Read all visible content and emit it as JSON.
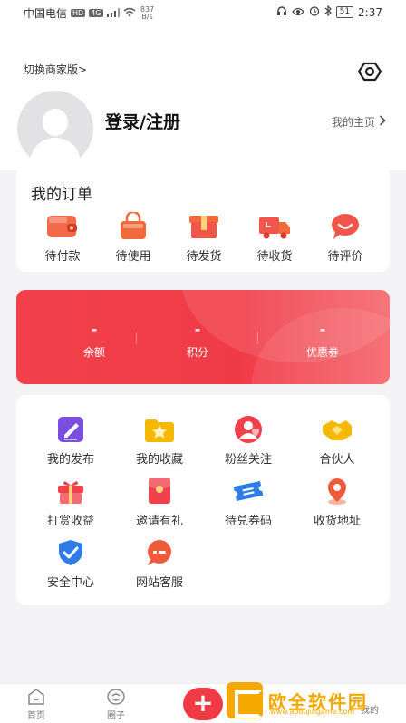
{
  "status_bar": {
    "carrier": "中国电信",
    "hd": "HD",
    "net": "4G",
    "speed_value": "837",
    "speed_unit": "B/s",
    "battery": "51",
    "time": "2:37"
  },
  "header": {
    "switch_label": "切换商家版>",
    "login_label": "登录/注册",
    "homepage_label": "我的主页"
  },
  "orders": {
    "title": "我的订单",
    "items": [
      {
        "label": "待付款",
        "icon": "wallet-icon",
        "color": "#f2564a"
      },
      {
        "label": "待使用",
        "icon": "bag-icon",
        "color": "#f26a3c"
      },
      {
        "label": "待发货",
        "icon": "box-icon",
        "color": "#f2554a"
      },
      {
        "label": "待收货",
        "icon": "truck-icon",
        "color": "#f2554a"
      },
      {
        "label": "待评价",
        "icon": "comment-icon",
        "color": "#f2554a"
      }
    ]
  },
  "wallet": {
    "items": [
      {
        "value": "-",
        "label": "余额"
      },
      {
        "value": "-",
        "label": "积分"
      },
      {
        "value": "-",
        "label": "优惠券"
      }
    ],
    "color": "#f03b47"
  },
  "services": {
    "items": [
      {
        "label": "我的发布",
        "icon": "edit-icon",
        "color": "#7a4fe0"
      },
      {
        "label": "我的收藏",
        "icon": "star-folder-icon",
        "color": "#f5b800"
      },
      {
        "label": "粉丝关注",
        "icon": "fans-icon",
        "color": "#f0414c"
      },
      {
        "label": "合伙人",
        "icon": "handshake-icon",
        "color": "#f5b800"
      },
      {
        "label": "打赏收益",
        "icon": "gift-icon",
        "color": "#f0414c"
      },
      {
        "label": "邀请有礼",
        "icon": "red-envelope-icon",
        "color": "#f0414c"
      },
      {
        "label": "待兑券码",
        "icon": "ticket-icon",
        "color": "#2f7ce8"
      },
      {
        "label": "收货地址",
        "icon": "location-icon",
        "color": "#f05a3c"
      },
      {
        "label": "安全中心",
        "icon": "shield-icon",
        "color": "#2f7ce8"
      },
      {
        "label": "网站客服",
        "icon": "service-icon",
        "color": "#f05a3c"
      }
    ]
  },
  "tabbar": {
    "home": "首页",
    "circle": "圈子",
    "add": "+",
    "mine": "我的"
  },
  "watermark": {
    "text": "欧全软件园",
    "url": "www.apoujingame.com"
  }
}
